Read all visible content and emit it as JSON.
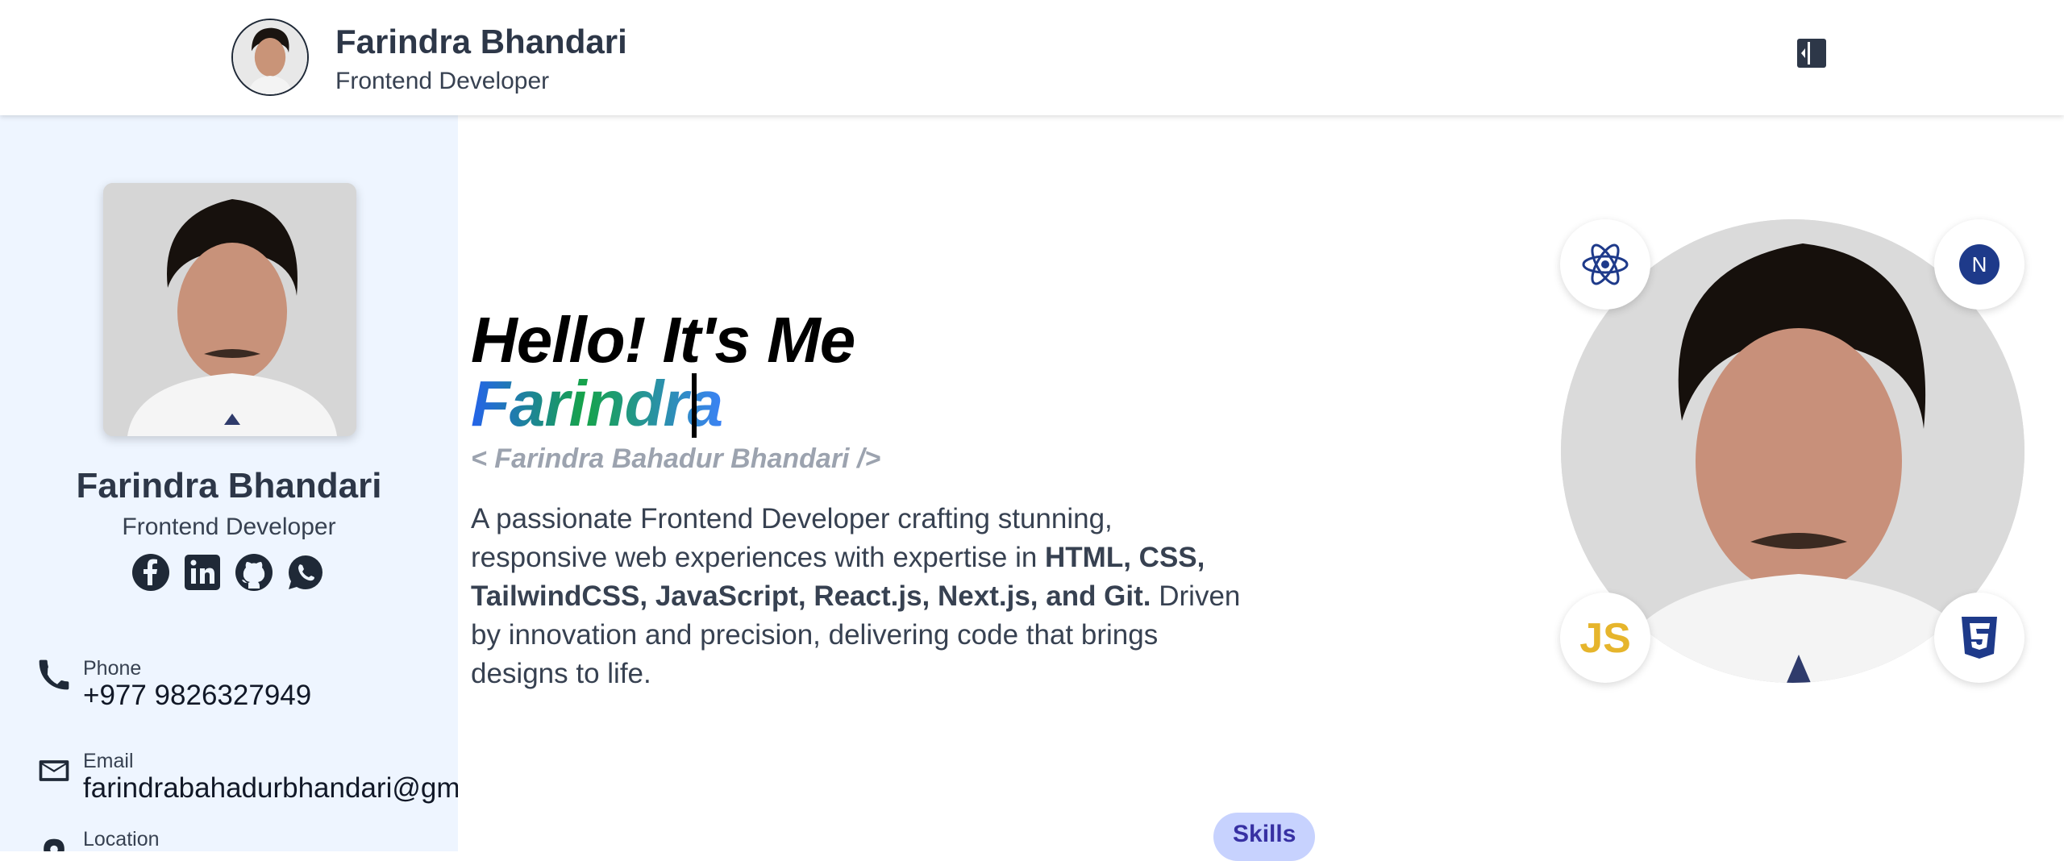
{
  "header": {
    "name": "Farindra Bhandari",
    "role": "Frontend Developer",
    "toggle_icon": "sidebar-toggle-icon"
  },
  "sidebar": {
    "name": "Farindra Bhandari",
    "role": "Frontend Developer",
    "social": [
      "facebook-icon",
      "linkedin-icon",
      "github-icon",
      "whatsapp-icon"
    ],
    "contacts": [
      {
        "label": "Phone",
        "value": "+977 9826327949",
        "icon": "phone-icon"
      },
      {
        "label": "Email",
        "value": "farindrabahadurbhandari@gmail.com",
        "icon": "mail-icon"
      },
      {
        "label": "Location",
        "value": "",
        "icon": "location-icon"
      }
    ]
  },
  "hero": {
    "greeting": "Hello! It's Me",
    "typed_text": "Farindra",
    "code_tag": "< Farindra Bahadur Bhandari />",
    "bio_start": "A passionate Frontend Developer crafting stunning, responsive web experiences with expertise in ",
    "bio_bold": "HTML, CSS, TailwindCSS, JavaScript, React.js, Next.js, and Git.",
    "bio_end": " Driven by innovation and precision, delivering code that brings designs to life.",
    "badges": [
      "react-icon",
      "nextjs-icon",
      "javascript-icon",
      "css3-icon"
    ],
    "badge_js_text": "JS",
    "badge_next_text": "N"
  },
  "skills": {
    "label": "Skills"
  },
  "colors": {
    "sidebar_bg": "#eef5ff",
    "accent": "#1e3a8a",
    "js_yellow": "#e6b52c",
    "pill_bg": "#c7d2fe"
  }
}
